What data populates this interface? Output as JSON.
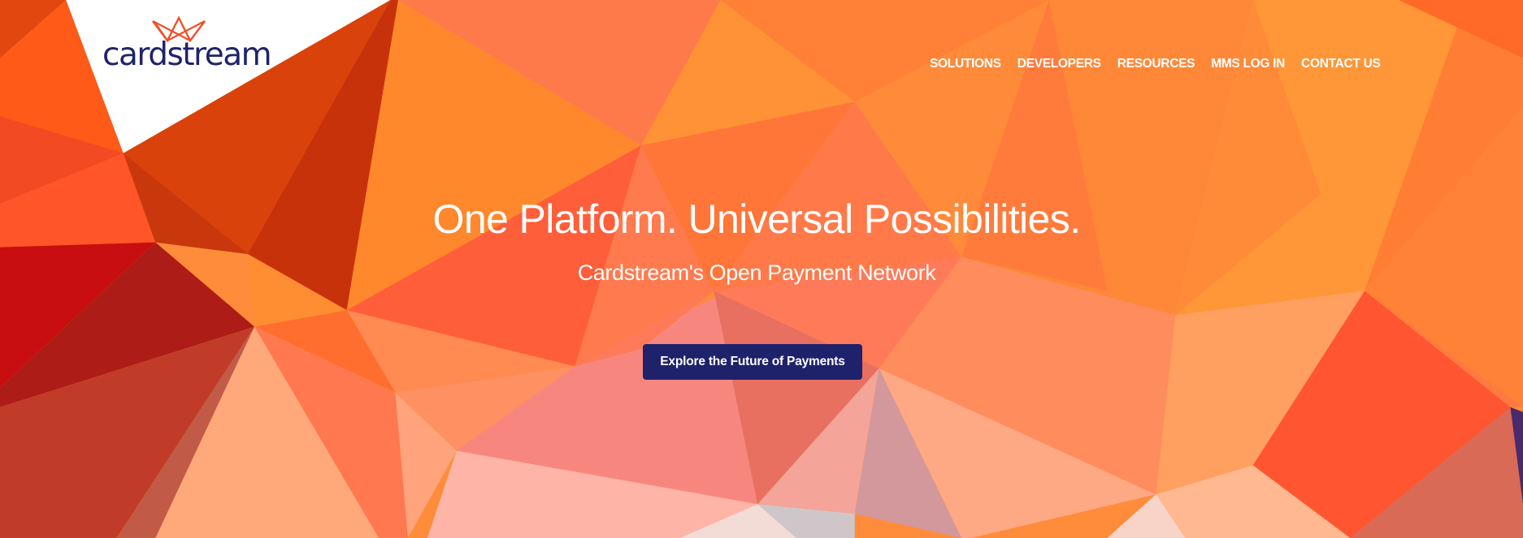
{
  "brand": {
    "name": "cardstream",
    "logo_icon": "crown-icon",
    "logo_text_color": "#20236a",
    "crown_color": "#f0502a"
  },
  "nav": {
    "items": [
      {
        "label": "SOLUTIONS"
      },
      {
        "label": "DEVELOPERS"
      },
      {
        "label": "RESOURCES"
      },
      {
        "label": "MMS LOG IN"
      },
      {
        "label": "CONTACT US"
      }
    ]
  },
  "hero": {
    "title": "One Platform. Universal Possibilities.",
    "subtitle": "Cardstream's Open Payment Network",
    "cta_label": "Explore the Future of Payments",
    "cta_color": "#1e226b",
    "background": "low-poly-orange-pattern"
  }
}
